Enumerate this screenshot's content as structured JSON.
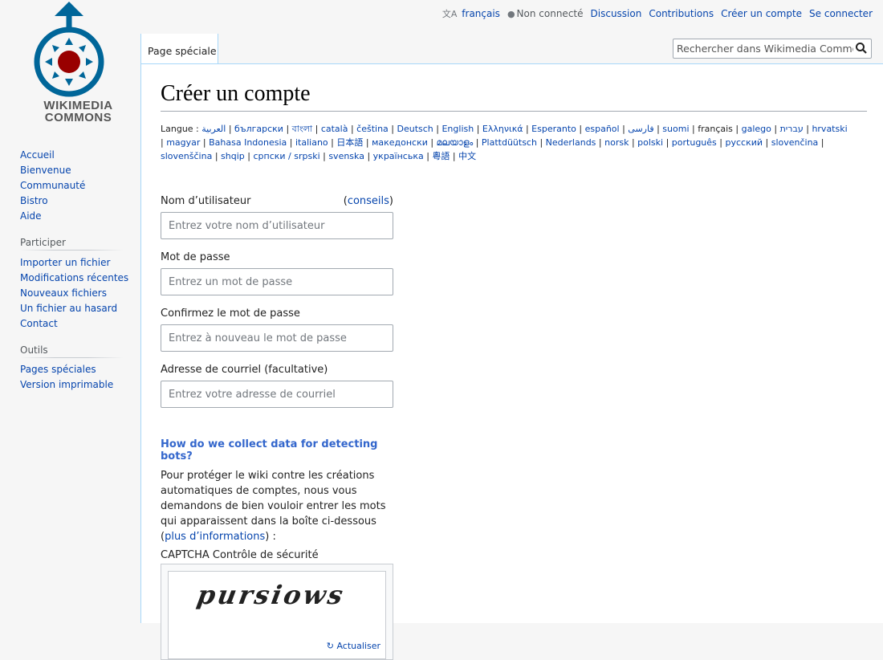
{
  "logo": {
    "line1": "WIKIMEDIA",
    "line2": "COMMONS"
  },
  "personal": {
    "language": "français",
    "not_logged": "Non connecté",
    "discussion": "Discussion",
    "contributions": "Contributions",
    "create_account": "Créer un compte",
    "login": "Se connecter"
  },
  "tab": {
    "label": "Page spéciale"
  },
  "search": {
    "placeholder": "Rechercher dans Wikimedia Commons"
  },
  "page": {
    "title": "Créer un compte"
  },
  "languages": {
    "label": "Langue :",
    "items": [
      "العربية",
      "български",
      "বাংলা",
      "català",
      "čeština",
      "Deutsch",
      "English",
      "Ελληνικά",
      "Esperanto",
      "español",
      "فارسی",
      "suomi",
      "français",
      "galego",
      "עברית",
      "hrvatski",
      "magyar",
      "Bahasa Indonesia",
      "italiano",
      "日本語",
      "македонски",
      "മലയാളം",
      "Plattdüütsch",
      "Nederlands",
      "norsk",
      "polski",
      "português",
      "русский",
      "slovenčina",
      "slovenščina",
      "shqip",
      "српски / srpski",
      "svenska",
      "українська",
      "粵語",
      "中文"
    ],
    "current": "français"
  },
  "form": {
    "username_label": "Nom d’utilisateur",
    "username_help_link": "conseils",
    "username_placeholder": "Entrez votre nom d’utilisateur",
    "password_label": "Mot de passe",
    "password_placeholder": "Entrez un mot de passe",
    "confirm_label": "Confirmez le mot de passe",
    "confirm_placeholder": "Entrez à nouveau le mot de passe",
    "email_label": "Adresse de courriel (facultative)",
    "email_placeholder": "Entrez votre adresse de courriel",
    "bots_title": "How do we collect data for detecting bots?",
    "bots_text": "Pour protéger le wiki contre les créations automatiques de comptes, nous vous demandons de bien vouloir entrer les mots qui apparaissent dans la boîte ci-dessous (",
    "bots_link": "plus d’informations",
    "bots_text_end": ") :",
    "captcha_label": "CAPTCHA Contrôle de sécurité",
    "captcha_word": "pursiows",
    "refresh": "Actualiser"
  },
  "sidebar": {
    "nav": [
      "Accueil",
      "Bienvenue",
      "Communauté",
      "Bistro",
      "Aide"
    ],
    "participate_heading": "Participer",
    "participate": [
      "Importer un fichier",
      "Modifications récentes",
      "Nouveaux fichiers",
      "Un fichier au hasard",
      "Contact"
    ],
    "tools_heading": "Outils",
    "tools": [
      "Pages spéciales",
      "Version imprimable"
    ]
  },
  "colors": {
    "link": "#0645ad",
    "logo_blue": "#069",
    "logo_red": "#900"
  }
}
